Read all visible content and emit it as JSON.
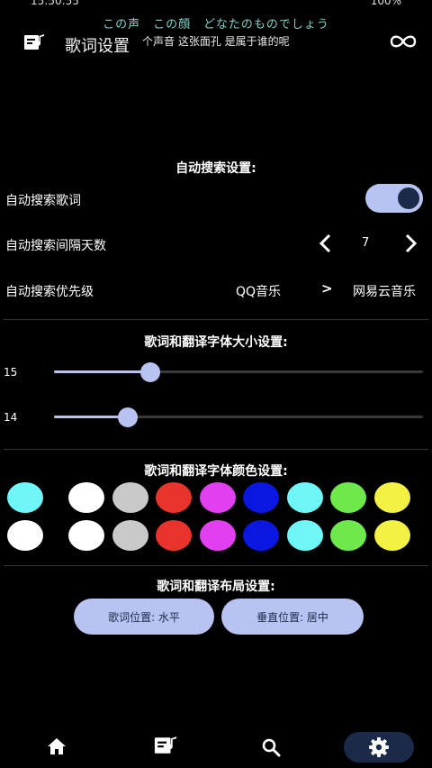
{
  "status_bar": {
    "time": "15:50:55",
    "battery": "100%"
  },
  "now_playing": {
    "line1": "この声　この顔　どなたのものでしょう",
    "line2": "个声音 这张面孔 是属于谁的呢"
  },
  "header": {
    "title": "歌词设置",
    "icon": "lyrics-icon",
    "right_icon": "infinity-icon"
  },
  "auto_search": {
    "title": "自动搜索设置:",
    "auto_label": "自动搜索歌词",
    "auto_enabled": true,
    "interval_label": "自动搜索间隔天数",
    "interval_value": "7",
    "priority_label": "自动搜索优先级",
    "priority_first": "QQ音乐",
    "priority_arrow": ">",
    "priority_second": "网易云音乐"
  },
  "font_size": {
    "title": "歌词和翻译字体大小设置:",
    "lyric_size": "15",
    "lyric_fraction": 0.26,
    "translation_size": "14",
    "translation_fraction": 0.2
  },
  "font_color": {
    "title": "歌词和翻译字体颜色设置:",
    "lyric_selected": "#6ff6f8",
    "translation_selected": "#ffffff",
    "palette": [
      "#ffffff",
      "#c9c9c9",
      "#e8332b",
      "#e23ff0",
      "#0a17e0",
      "#6ff6f8",
      "#6ee84a",
      "#f4f145"
    ]
  },
  "layout": {
    "title": "歌词和翻译布局设置:",
    "lyric_position": "歌词位置: 水平",
    "vertical_position": "垂直位置: 居中"
  },
  "nav": {
    "items": [
      "home-icon",
      "lyrics-icon",
      "search-icon",
      "settings-icon"
    ],
    "active": "settings-icon"
  },
  "colors": {
    "accent": "#b8c3f2",
    "accent_dark": "#1c2a4a"
  }
}
